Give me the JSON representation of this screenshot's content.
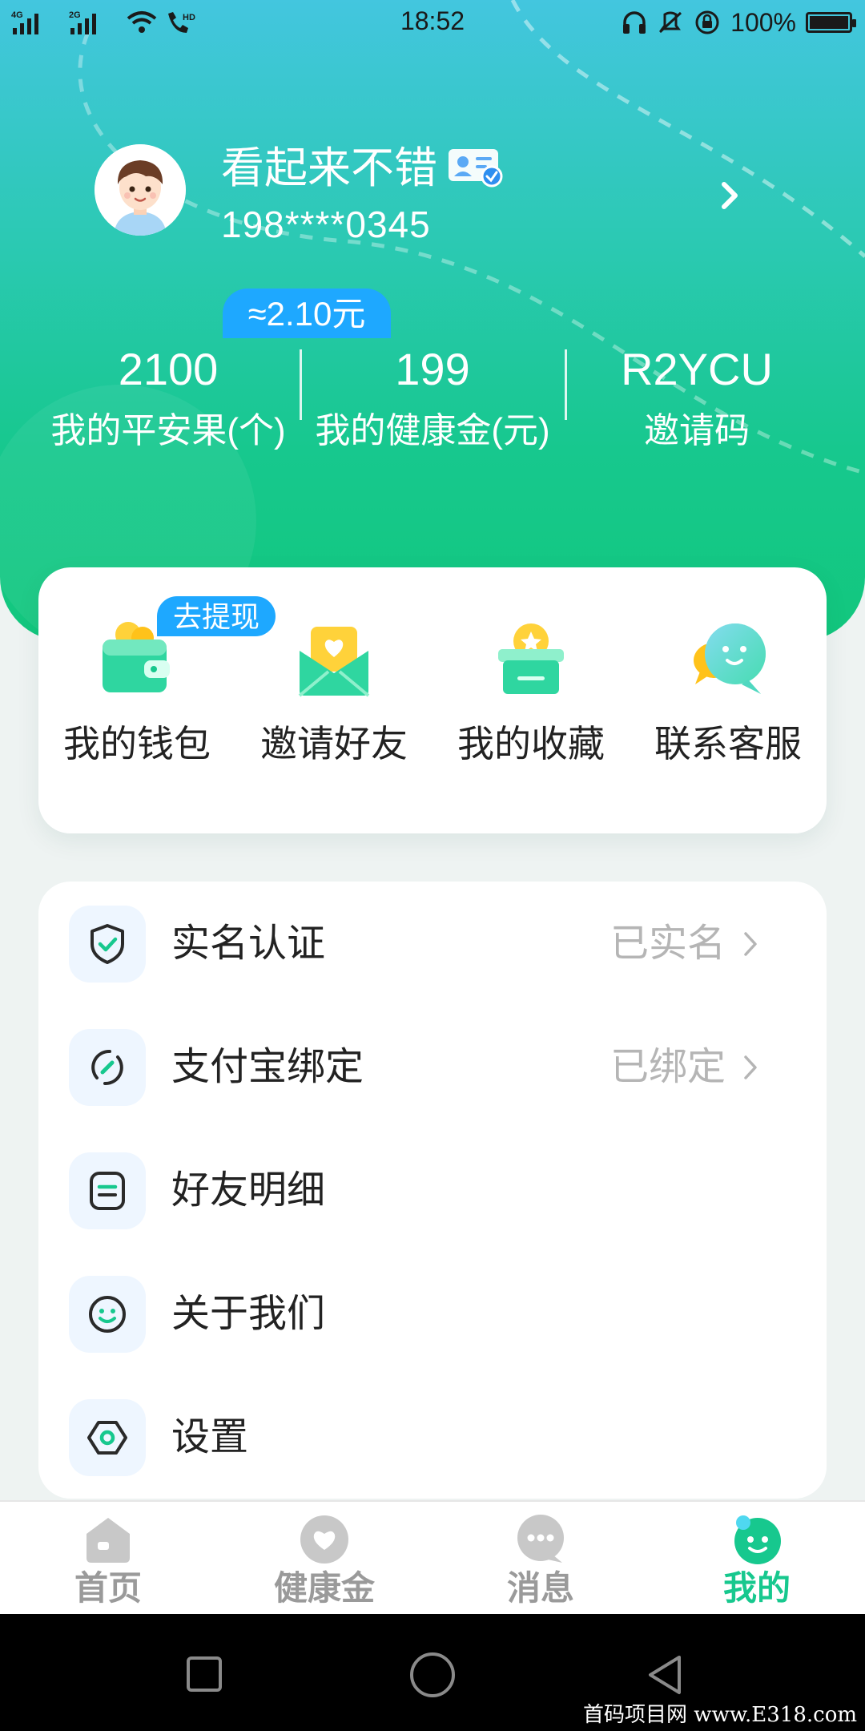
{
  "status_bar": {
    "network_1": "4G",
    "network_2": "2G",
    "call_badge": "HD",
    "time": "18:52",
    "battery": "100%",
    "battery_level": 1.0
  },
  "profile": {
    "nickname": "看起来不错",
    "phone": "198****0345"
  },
  "stats": {
    "approx_value": "≈2.10元",
    "items": [
      {
        "value": "2100",
        "label": "我的平安果(个)"
      },
      {
        "value": "199",
        "label": "我的健康金(元)"
      },
      {
        "value": "R2YCU",
        "label": "邀请码"
      }
    ]
  },
  "quick_actions": {
    "withdraw_tag": "去提现",
    "items": [
      {
        "label": "我的钱包",
        "icon": "wallet-icon"
      },
      {
        "label": "邀请好友",
        "icon": "invite-envelope-icon"
      },
      {
        "label": "我的收藏",
        "icon": "favorites-box-icon"
      },
      {
        "label": "联系客服",
        "icon": "customer-service-chat-icon"
      }
    ]
  },
  "menu": {
    "items": [
      {
        "label": "实名认证",
        "status": "已实名",
        "icon": "shield-check-icon"
      },
      {
        "label": "支付宝绑定",
        "status": "已绑定",
        "icon": "link-bind-icon"
      },
      {
        "label": "好友明细",
        "status": "",
        "icon": "detail-list-icon"
      },
      {
        "label": "关于我们",
        "status": "",
        "icon": "smile-icon"
      },
      {
        "label": "设置",
        "status": "",
        "icon": "settings-hexagon-icon"
      }
    ]
  },
  "tab_bar": {
    "active_index": 3,
    "items": [
      {
        "label": "首页",
        "icon": "home-icon"
      },
      {
        "label": "健康金",
        "icon": "heart-icon"
      },
      {
        "label": "消息",
        "icon": "message-icon"
      },
      {
        "label": "我的",
        "icon": "profile-face-icon"
      }
    ]
  },
  "watermark": "首码项目网 www.E318.com",
  "colors": {
    "brand_green": "#17c88e",
    "accent_blue": "#1ea8ff",
    "header_top": "#43c6df",
    "muted_text": "#b5b5b5"
  }
}
